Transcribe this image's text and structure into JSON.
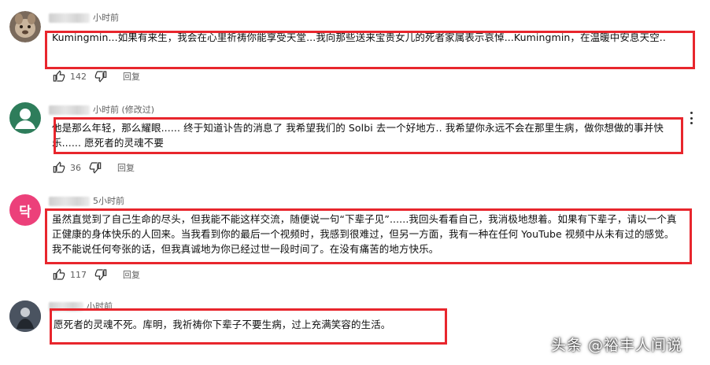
{
  "comments": [
    {
      "time": "小时前",
      "edited": "",
      "text": "Kumingmin...如果有来生，我会在心里祈祷你能享受天堂...我向那些送来宝贵女儿的死者家属表示哀悼...Kumingmin，在温暖中安息天空..",
      "likes": "142",
      "reply_label": "回复"
    },
    {
      "time": "小时前",
      "edited": "(修改过)",
      "text": "他是那么年轻，那么耀眼...... 终于知道讣告的消息了 我希望我们的 Solbi 去一个好地方.. 我希望你永远不会在那里生病，做你想做的事并快乐...... 愿死者的灵魂不要",
      "likes": "36",
      "reply_label": "回复"
    },
    {
      "avatar_letter": "닥",
      "time": "5小时前",
      "edited": "",
      "text": "虽然直觉到了自己生命的尽头，但我能不能这样交流，随便说一句“下辈子见”......我回头看看自己，我消极地想着。如果有下辈子，请以一个真正健康的身体快乐的人回来。当我看到你的最后一个视频时，我感到很难过，但另一方面，我有一种在任何 YouTube 视频中从未有过的感觉。我不能说任何夸张的话，但我真诚地为你已经过世一段时间了。在没有痛苦的地方快乐。",
      "likes": "117",
      "reply_label": "回复"
    },
    {
      "time": "小时前",
      "edited": "",
      "text": "愿死者的灵魂不死。库明，我祈祷你下辈子不要生病，过上充满笑容的生活。"
    }
  ],
  "watermark": "头条 @裕丰人间说",
  "colors": {
    "highlight_box": "#e8262d",
    "secondary_text": "#606060",
    "avatar_green": "#2e7d5b",
    "avatar_pink": "#ec407a"
  }
}
